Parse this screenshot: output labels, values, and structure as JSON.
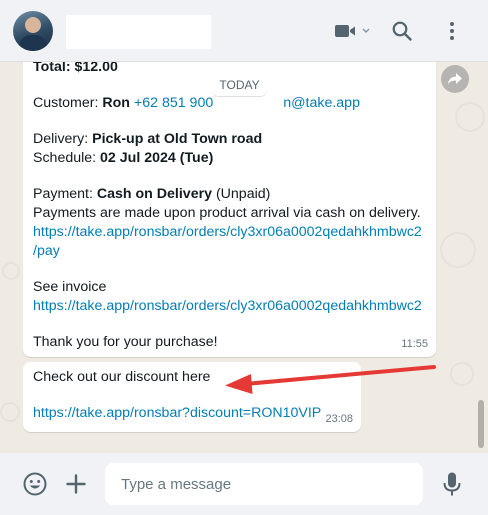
{
  "header": {
    "contact_name": "",
    "icons": [
      "avatar",
      "video-call-icon",
      "chevron-down-icon",
      "search-icon",
      "menu-icon"
    ]
  },
  "date_chip": "TODAY",
  "messages": [
    {
      "lines": {
        "total": "Total: $12.00",
        "customer_label": "Customer: ",
        "customer_name": "Ron",
        "customer_phone": "+62 851 900",
        "customer_email_tail": "n@take.app",
        "delivery_label": "Delivery: ",
        "delivery_value": "Pick-up at Old Town road",
        "schedule_label": "Schedule: ",
        "schedule_value": "02 Jul 2024 (Tue)",
        "payment_label": "Payment: ",
        "payment_method": "Cash on Delivery",
        "payment_status": " (Unpaid)",
        "payment_note": "Payments are made upon product arrival via cash on delivery.",
        "pay_link_1": "https://take.app/ronsbar/orders/cly3xr06a0002qedahkhmbwc2",
        "pay_link_2": "/pay",
        "invoice_label": "See invoice",
        "invoice_link": "https://take.app/ronsbar/orders/cly3xr06a0002qedahkhmbwc2",
        "thanks": "Thank you for your purchase!"
      },
      "time": "11:55"
    },
    {
      "lines": {
        "text": "Check out our discount here",
        "link": "https://take.app/ronsbar?discount=RON10VIP"
      },
      "time": "23:08"
    }
  ],
  "composer": {
    "placeholder": "Type a message",
    "icons": [
      "emoji-icon",
      "plus-icon",
      "mic-icon"
    ]
  },
  "colors": {
    "header_bg": "#f0f2f5",
    "chat_bg": "#efeae2",
    "bubble_bg": "#ffffff",
    "link": "#027eb5",
    "annotation_arrow": "#e53935"
  }
}
